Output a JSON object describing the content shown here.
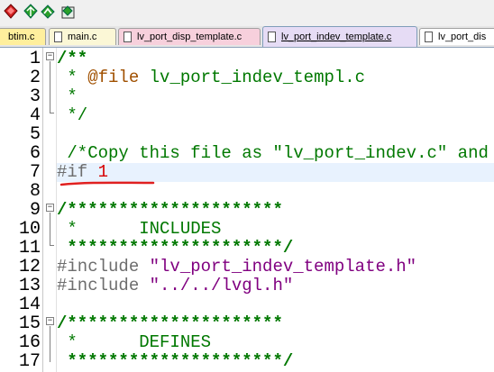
{
  "toolbar": {
    "buttons": [
      {
        "icon": "bookmark-red-icon"
      },
      {
        "icon": "bookmark-green-icon"
      },
      {
        "icon": "bookmark-prev-icon"
      },
      {
        "icon": "bookmark-clear-icon"
      }
    ]
  },
  "tabs": [
    {
      "label": "btim.c",
      "color": "#ffef9d"
    },
    {
      "label": "main.c",
      "color": "#fbf7d6"
    },
    {
      "label": "lv_port_disp_template.c",
      "color": "#f7d0dc"
    },
    {
      "label": "lv_port_indev_template.c",
      "color": "#e6dcf5",
      "active": true
    },
    {
      "label": "lv_port_dis",
      "color": "#ffffff"
    }
  ],
  "editor": {
    "current_line": 7,
    "lines": [
      {
        "n": "1",
        "segs": [
          {
            "t": "/**",
            "c": "c-cbold"
          }
        ]
      },
      {
        "n": "2",
        "segs": [
          {
            "t": " * ",
            "c": "c-comment"
          },
          {
            "t": "@file",
            "c": "c-doctag"
          },
          {
            "t": " lv_port_indev_templ.c",
            "c": "c-comment"
          }
        ]
      },
      {
        "n": "3",
        "segs": [
          {
            "t": " *",
            "c": "c-comment"
          }
        ]
      },
      {
        "n": "4",
        "segs": [
          {
            "t": " */",
            "c": "c-comment"
          }
        ]
      },
      {
        "n": "5",
        "segs": []
      },
      {
        "n": "6",
        "segs": [
          {
            "t": " /*Copy this file as \"lv_port_indev.c\" and",
            "c": "c-comment"
          }
        ]
      },
      {
        "n": "7",
        "segs": [
          {
            "t": "#if ",
            "c": "c-pre"
          },
          {
            "t": "1",
            "c": "c-num"
          }
        ]
      },
      {
        "n": "8",
        "segs": []
      },
      {
        "n": "9",
        "segs": [
          {
            "t": "/*********************",
            "c": "c-cbold"
          }
        ]
      },
      {
        "n": "10",
        "segs": [
          {
            "t": " *      INCLUDES",
            "c": "c-comment"
          }
        ]
      },
      {
        "n": "11",
        "segs": [
          {
            "t": " *********************/",
            "c": "c-cbold"
          }
        ]
      },
      {
        "n": "12",
        "segs": [
          {
            "t": "#include ",
            "c": "c-pre"
          },
          {
            "t": "\"lv_port_indev_template.h\"",
            "c": "c-str"
          }
        ]
      },
      {
        "n": "13",
        "segs": [
          {
            "t": "#include ",
            "c": "c-pre"
          },
          {
            "t": "\"../../lvgl.h\"",
            "c": "c-str"
          }
        ]
      },
      {
        "n": "14",
        "segs": []
      },
      {
        "n": "15",
        "segs": [
          {
            "t": "/*********************",
            "c": "c-cbold"
          }
        ]
      },
      {
        "n": "16",
        "segs": [
          {
            "t": " *      DEFINES",
            "c": "c-comment"
          }
        ]
      },
      {
        "n": "17",
        "segs": [
          {
            "t": " *********************/",
            "c": "c-cbold"
          }
        ]
      }
    ]
  },
  "annotation": {
    "color": "#e02020"
  }
}
